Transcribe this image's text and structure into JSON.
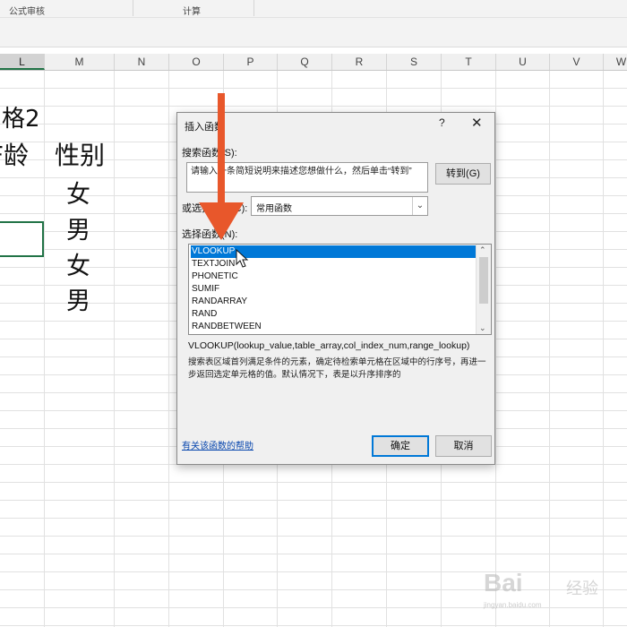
{
  "ribbon": {
    "groups": [
      "公式审核",
      "计算"
    ]
  },
  "sheet": {
    "columns": [
      "L",
      "M",
      "N",
      "O",
      "P",
      "Q",
      "R",
      "S",
      "T",
      "U",
      "V",
      "W"
    ],
    "selected_column": "L",
    "title_text": "格2",
    "headers": [
      "F龄",
      "性别"
    ],
    "gender_values": [
      "女",
      "男",
      "女",
      "男"
    ]
  },
  "dialog": {
    "title": "插入函数",
    "help_glyph": "?",
    "close_glyph": "✕",
    "search_label": "搜索函数(S):",
    "search_value": "请输入一条简短说明来描述您想做什么，然后单击“转到”",
    "go_button": "转到(G)",
    "category_label": "或选择类别(C):",
    "category_value": "常用函数",
    "select_label": "选择函数(N):",
    "functions": [
      "VLOOKUP",
      "TEXTJOIN",
      "PHONETIC",
      "SUMIF",
      "RANDARRAY",
      "RAND",
      "RANDBETWEEN"
    ],
    "selected_function": "VLOOKUP",
    "signature": "VLOOKUP(lookup_value,table_array,col_index_num,range_lookup)",
    "description": "搜索表区域首列满足条件的元素，确定待检索单元格在区域中的行序号，再进一步返回选定单元格的值。默认情况下，表是以升序排序的",
    "help_link": "有关该函数的帮助",
    "ok_button": "确定",
    "cancel_button": "取消"
  },
  "annotation": {
    "arrow_color": "#e8572b"
  },
  "watermark": {
    "text": "Bai",
    "sub": "经验",
    "url": "jingyan.baidu.com"
  }
}
